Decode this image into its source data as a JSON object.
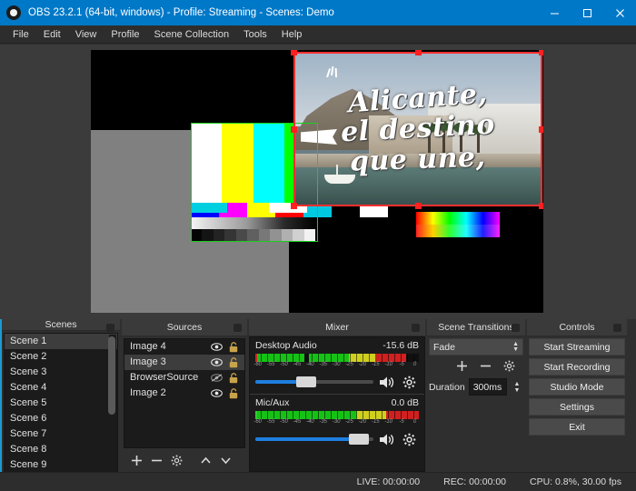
{
  "window": {
    "title": "OBS 23.2.1 (64-bit, windows) - Profile: Streaming - Scenes: Demo",
    "logo_icon": "obs-logo-icon",
    "minimize_icon": "minimize-icon",
    "maximize_icon": "maximize-icon",
    "close_icon": "close-icon",
    "titlebar_color": "#0078c8"
  },
  "menu": {
    "items": [
      {
        "label": "File"
      },
      {
        "label": "Edit"
      },
      {
        "label": "View"
      },
      {
        "label": "Profile"
      },
      {
        "label": "Scene Collection"
      },
      {
        "label": "Tools"
      },
      {
        "label": "Help"
      }
    ]
  },
  "preview": {
    "selected_source_text": {
      "line1": "Alicante,",
      "line2": "el destino",
      "line3": "que une,"
    },
    "selection_color": "#ff2f2f",
    "secondary_selection_color": "#18d018"
  },
  "scenes": {
    "title": "Scenes",
    "close_icon": "panel-close-icon",
    "items": [
      {
        "label": "Scene 1",
        "selected": true
      },
      {
        "label": "Scene 2",
        "selected": false
      },
      {
        "label": "Scene 3",
        "selected": false
      },
      {
        "label": "Scene 4",
        "selected": false
      },
      {
        "label": "Scene 5",
        "selected": false
      },
      {
        "label": "Scene 6",
        "selected": false
      },
      {
        "label": "Scene 7",
        "selected": false
      },
      {
        "label": "Scene 8",
        "selected": false
      },
      {
        "label": "Scene 9",
        "selected": false
      }
    ],
    "tools": {
      "add": "add-icon",
      "remove": "remove-icon",
      "move_up": "chevron-up-icon",
      "move_down": "chevron-down-icon"
    }
  },
  "sources": {
    "title": "Sources",
    "close_icon": "panel-close-icon",
    "items": [
      {
        "label": "Image 4",
        "visible": true,
        "locked": false,
        "selected": false
      },
      {
        "label": "Image 3",
        "visible": true,
        "locked": false,
        "selected": true
      },
      {
        "label": "BrowserSource",
        "visible": false,
        "locked": false,
        "selected": false
      },
      {
        "label": "Image 2",
        "visible": true,
        "locked": false,
        "selected": false
      }
    ],
    "tools": {
      "add": "add-icon",
      "remove": "remove-icon",
      "properties": "gear-icon",
      "move_up": "chevron-up-icon",
      "move_down": "chevron-down-icon"
    }
  },
  "mixer": {
    "title": "Mixer",
    "close_icon": "panel-close-icon",
    "scale_labels": [
      "-60",
      "-55",
      "-50",
      "-45",
      "-40",
      "-35",
      "-30",
      "-25",
      "-20",
      "-15",
      "-10",
      "-5",
      "0"
    ],
    "channels": [
      {
        "name": "Desktop Audio",
        "level_db": "-15.6 dB",
        "meter_percent": 92,
        "volume_percent": 43,
        "mute_icon": "speaker-icon",
        "settings_icon": "gear-icon"
      },
      {
        "name": "Mic/Aux",
        "level_db": "0.0 dB",
        "meter_percent": 100,
        "volume_percent": 88,
        "mute_icon": "speaker-icon",
        "settings_icon": "gear-icon"
      }
    ]
  },
  "transitions": {
    "title": "Scene Transitions",
    "close_icon": "panel-close-icon",
    "selected": "Fade",
    "duration_label": "Duration",
    "duration_value": "300ms",
    "tools": {
      "add": "add-icon",
      "remove": "remove-icon",
      "properties": "gear-icon"
    }
  },
  "controls": {
    "title": "Controls",
    "close_icon": "panel-close-icon",
    "buttons": [
      {
        "label": "Start Streaming"
      },
      {
        "label": "Start Recording"
      },
      {
        "label": "Studio Mode"
      },
      {
        "label": "Settings"
      },
      {
        "label": "Exit"
      }
    ]
  },
  "status": {
    "live": "LIVE: 00:00:00",
    "rec": "REC: 00:00:00",
    "cpu": "CPU: 0.8%, 30.00 fps"
  }
}
